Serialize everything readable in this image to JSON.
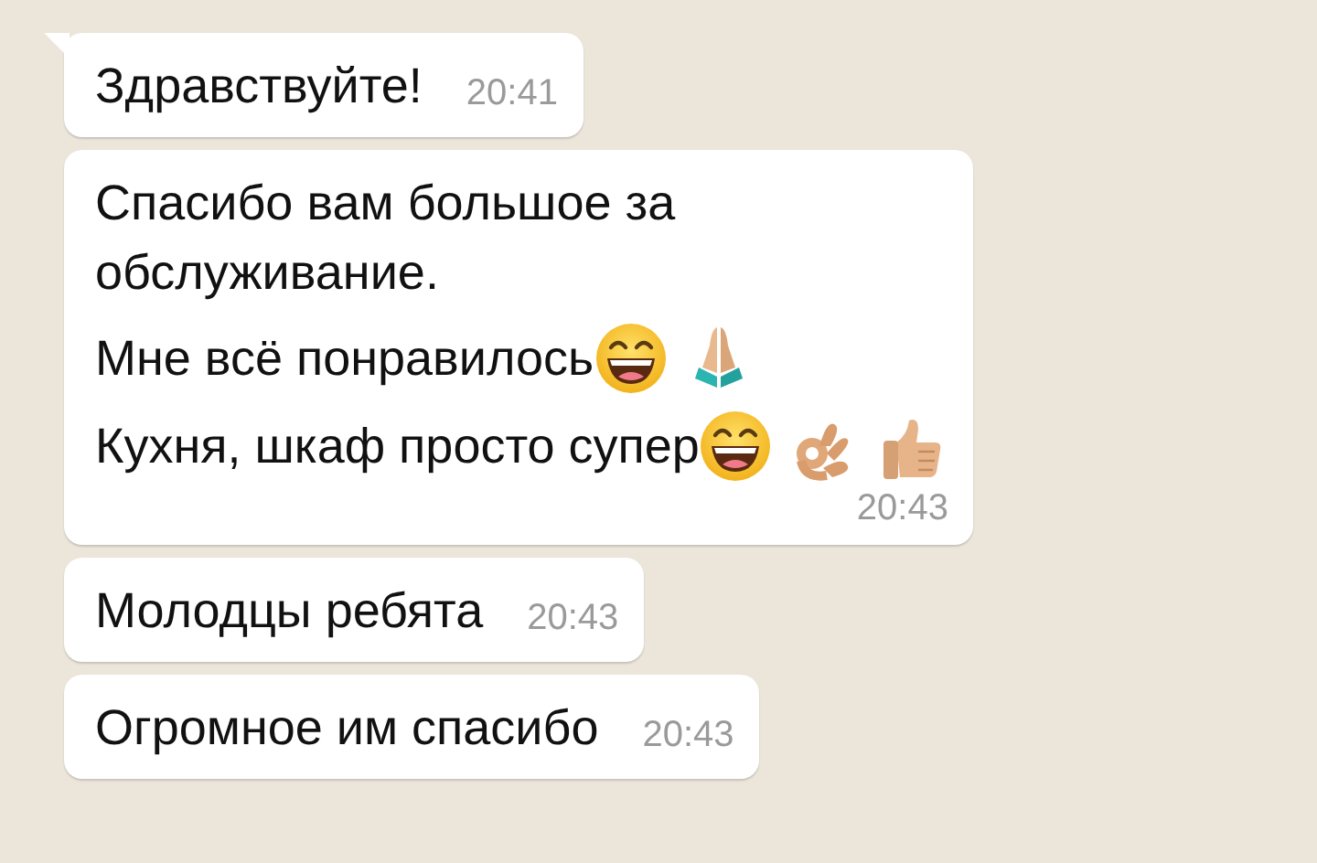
{
  "messages": [
    {
      "tail": true,
      "paragraphs": [
        {
          "text": "Здравствуйте!"
        }
      ],
      "time": "20:41"
    },
    {
      "tail": false,
      "paragraphs": [
        {
          "text": "Спасибо вам большое за\nобслуживание."
        },
        {
          "text": "Мне всё понравилось",
          "emoji": [
            {
              "kind": "grin"
            },
            {
              "kind": "pray"
            }
          ]
        },
        {
          "text": "Кухня, шкаф просто супер",
          "emoji": [
            {
              "kind": "grin"
            },
            {
              "kind": "ok"
            },
            {
              "kind": "thumb"
            }
          ]
        }
      ],
      "time": "20:43"
    },
    {
      "tail": false,
      "paragraphs": [
        {
          "text": "Молодцы ребята"
        }
      ],
      "time": "20:43"
    },
    {
      "tail": false,
      "paragraphs": [
        {
          "text": "Огромное им спасибо"
        }
      ],
      "time": "20:43"
    }
  ]
}
